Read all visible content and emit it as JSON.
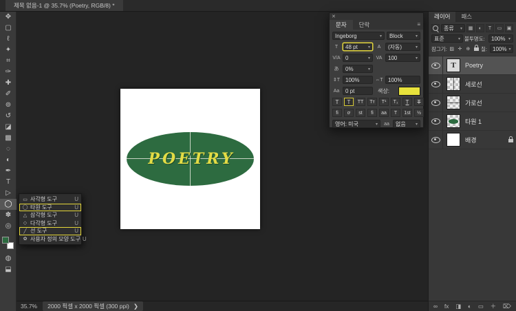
{
  "ui": {
    "caret": "▾"
  },
  "icons": {
    "close": "✕",
    "panel_menu": "≡"
  },
  "titlebar": {
    "tab_title": "제목 없음-1 @ 35.7% (Poetry, RGB/8) *"
  },
  "toolbar": {
    "tools": [
      {
        "name": "move-tool",
        "glyph": "✥"
      },
      {
        "name": "marquee-tool",
        "glyph": "▢"
      },
      {
        "name": "lasso-tool",
        "glyph": "ℓ"
      },
      {
        "name": "magic-wand-tool",
        "glyph": "✦"
      },
      {
        "name": "crop-tool",
        "glyph": "⌗"
      },
      {
        "name": "eyedropper-tool",
        "glyph": "✑"
      },
      {
        "name": "healing-brush-tool",
        "glyph": "✚"
      },
      {
        "name": "brush-tool",
        "glyph": "✐"
      },
      {
        "name": "clone-stamp-tool",
        "glyph": "⊚"
      },
      {
        "name": "history-brush-tool",
        "glyph": "↺"
      },
      {
        "name": "eraser-tool",
        "glyph": "◪"
      },
      {
        "name": "gradient-tool",
        "glyph": "▩"
      },
      {
        "name": "blur-tool",
        "glyph": "◌"
      },
      {
        "name": "dodge-tool",
        "glyph": "◐"
      },
      {
        "name": "pen-tool",
        "glyph": "✒"
      },
      {
        "name": "type-tool",
        "glyph": "T"
      },
      {
        "name": "path-select-tool",
        "glyph": "▷"
      },
      {
        "name": "shape-tool",
        "glyph": "◯"
      },
      {
        "name": "hand-tool",
        "glyph": "✽"
      },
      {
        "name": "zoom-tool",
        "glyph": "◎"
      }
    ]
  },
  "tool_flyout": {
    "items": [
      {
        "glyph": "▭",
        "label": "사각형 도구",
        "shortcut": "U"
      },
      {
        "glyph": "◯",
        "label": "타원 도구",
        "shortcut": "U"
      },
      {
        "glyph": "△",
        "label": "삼각형 도구",
        "shortcut": "U"
      },
      {
        "glyph": "◇",
        "label": "다각형 도구",
        "shortcut": "U"
      },
      {
        "glyph": "╱",
        "label": "선 도구",
        "shortcut": "U"
      },
      {
        "glyph": "✿",
        "label": "사용자 정의 모양 도구",
        "shortcut": "U"
      }
    ]
  },
  "canvas": {
    "artwork_text": "POETRY",
    "ellipse_color": "#2d6b40",
    "text_color": "#e3dc45",
    "canvas_background": "#ffffff"
  },
  "char_panel": {
    "tab_character": "문자",
    "tab_paragraph": "단락",
    "font_family": "Ingeborg",
    "font_style": "Block",
    "font_size": "48 pt",
    "leading": "(자동)",
    "kerning": "0",
    "tracking": "100",
    "tsume": "0%",
    "vertical_scale": "100%",
    "horizontal_scale": "100%",
    "baseline_shift": "0 pt",
    "color_label": "색상:",
    "color_value": "#e8e23c",
    "row_icons": {
      "size": "T",
      "leading": "A",
      "kerning": "V/A",
      "tracking": "VA",
      "tsume": "あ",
      "vscale": "⇕T",
      "hscale": "⇔T",
      "baseline": "Aa",
      "antialias": "aa"
    },
    "style_buttons": [
      "T",
      "T",
      "TT",
      "Tᴛ",
      "T¹",
      "T₁",
      "T",
      "T"
    ],
    "opentype_buttons": [
      "fi",
      "ơ",
      "st",
      "ﬁ",
      "aa",
      "T",
      "1st",
      "½"
    ],
    "language": "영어: 미국",
    "antialias": "없음"
  },
  "layers_panel": {
    "tab_layers": "레이어",
    "tab_paths": "패스",
    "filter_label": "종류",
    "filter_icons": [
      "▦",
      "◐",
      "T",
      "▭",
      "▣"
    ],
    "blend_mode": "표준",
    "opacity_label": "불투명도:",
    "opacity_value": "100%",
    "lock_label": "잠그기:",
    "lock_icons": [
      "▨",
      "✛",
      "⊕"
    ],
    "fill_label": "칠:",
    "fill_value": "100%",
    "layers": [
      {
        "name": "Poetry"
      },
      {
        "name": "세로선"
      },
      {
        "name": "가로선"
      },
      {
        "name": "타원 1"
      },
      {
        "name": "배경"
      }
    ],
    "footer_icons": [
      "∞",
      "fx",
      "◨",
      "◐",
      "▭",
      "＋",
      "⌦"
    ]
  },
  "statusbar": {
    "zoom_level": "35.7%",
    "doc_info": "2000 픽셀 x 2000 픽셀 (300 ppi)",
    "chevron": "❯"
  }
}
